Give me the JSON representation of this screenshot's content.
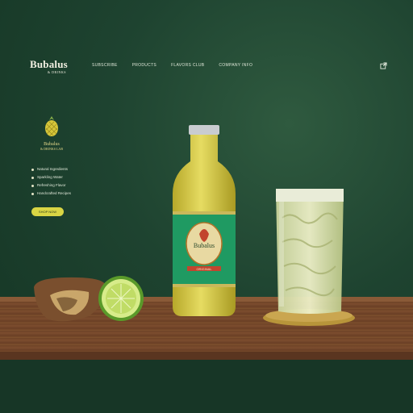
{
  "header": {
    "brand": "Bubalus",
    "brand_tagline": "& DRINKS",
    "nav": [
      "SUBSCRIBE",
      "PRODUCTS",
      "FLAVORS CLUB",
      "COMPANY INFO"
    ],
    "ext_icon": "external-link-icon"
  },
  "badge": {
    "icon": "pineapple-icon",
    "name": "Bubalus",
    "tagline": "& DRINKS LAB"
  },
  "features": [
    "Natural Ingredients",
    "Sparkling Water",
    "Refreshing Flavor",
    "Handcrafted Recipes"
  ],
  "cta": {
    "label": "SHOP NOW"
  },
  "product": {
    "label_title": "Bubalus",
    "label_sub": "ORIGINAL"
  },
  "colors": {
    "background": "#1e4330",
    "accent": "#d9d544",
    "label_green": "#1f9a62"
  }
}
